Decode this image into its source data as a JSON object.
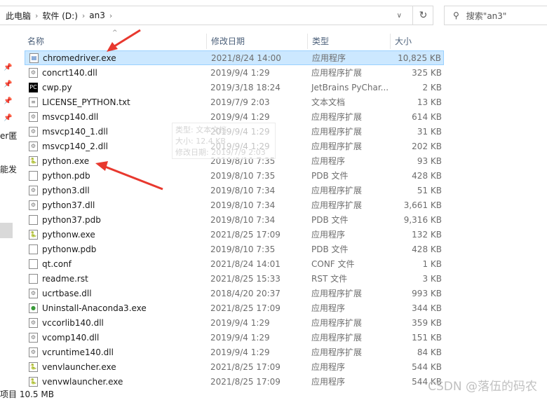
{
  "address": {
    "crumbs": [
      "此电脑",
      "软件 (D:)",
      "an3"
    ]
  },
  "search": {
    "placeholder": "搜索\"an3\""
  },
  "columns": [
    "名称",
    "修改日期",
    "类型",
    "大小"
  ],
  "sidebar": {
    "text1": "er匿",
    "text2": "能发"
  },
  "files": [
    {
      "name": "chromedriver.exe",
      "date": "2021/8/24 14:00",
      "type": "应用程序",
      "size": "10,825 KB",
      "icon": "exe"
    },
    {
      "name": "concrt140.dll",
      "date": "2019/9/4 1:29",
      "type": "应用程序扩展",
      "size": "325 KB",
      "icon": "dll"
    },
    {
      "name": "cwp.py",
      "date": "2019/3/18 18:24",
      "type": "JetBrains PyChar...",
      "size": "2 KB",
      "icon": "pycharm"
    },
    {
      "name": "LICENSE_PYTHON.txt",
      "date": "2019/7/9 2:03",
      "type": "文本文档",
      "size": "13 KB",
      "icon": "txt"
    },
    {
      "name": "msvcp140.dll",
      "date": "2019/9/4 1:29",
      "type": "应用程序扩展",
      "size": "614 KB",
      "icon": "dll"
    },
    {
      "name": "msvcp140_1.dll",
      "date": "2019/9/4 1:29",
      "type": "应用程序扩展",
      "size": "31 KB",
      "icon": "dll"
    },
    {
      "name": "msvcp140_2.dll",
      "date": "2019/9/4 1:29",
      "type": "应用程序扩展",
      "size": "202 KB",
      "icon": "dll"
    },
    {
      "name": "python.exe",
      "date": "2019/8/10 7:35",
      "type": "应用程序",
      "size": "93 KB",
      "icon": "python"
    },
    {
      "name": "python.pdb",
      "date": "2019/8/10 7:35",
      "type": "PDB 文件",
      "size": "428 KB",
      "icon": "file"
    },
    {
      "name": "python3.dll",
      "date": "2019/8/10 7:34",
      "type": "应用程序扩展",
      "size": "51 KB",
      "icon": "dll"
    },
    {
      "name": "python37.dll",
      "date": "2019/8/10 7:34",
      "type": "应用程序扩展",
      "size": "3,661 KB",
      "icon": "dll"
    },
    {
      "name": "python37.pdb",
      "date": "2019/8/10 7:34",
      "type": "PDB 文件",
      "size": "9,316 KB",
      "icon": "file"
    },
    {
      "name": "pythonw.exe",
      "date": "2021/8/25 17:09",
      "type": "应用程序",
      "size": "132 KB",
      "icon": "python"
    },
    {
      "name": "pythonw.pdb",
      "date": "2019/8/10 7:35",
      "type": "PDB 文件",
      "size": "428 KB",
      "icon": "file"
    },
    {
      "name": "qt.conf",
      "date": "2021/8/24 14:01",
      "type": "CONF 文件",
      "size": "1 KB",
      "icon": "file"
    },
    {
      "name": "readme.rst",
      "date": "2021/8/25 15:33",
      "type": "RST 文件",
      "size": "3 KB",
      "icon": "file"
    },
    {
      "name": "ucrtbase.dll",
      "date": "2018/4/20 20:37",
      "type": "应用程序扩展",
      "size": "993 KB",
      "icon": "dll"
    },
    {
      "name": "Uninstall-Anaconda3.exe",
      "date": "2021/8/25 17:09",
      "type": "应用程序",
      "size": "344 KB",
      "icon": "uninstall"
    },
    {
      "name": "vccorlib140.dll",
      "date": "2019/9/4 1:29",
      "type": "应用程序扩展",
      "size": "359 KB",
      "icon": "dll"
    },
    {
      "name": "vcomp140.dll",
      "date": "2019/9/4 1:29",
      "type": "应用程序扩展",
      "size": "151 KB",
      "icon": "dll"
    },
    {
      "name": "vcruntime140.dll",
      "date": "2019/9/4 1:29",
      "type": "应用程序扩展",
      "size": "84 KB",
      "icon": "dll"
    },
    {
      "name": "venvlauncher.exe",
      "date": "2021/8/25 17:09",
      "type": "应用程序",
      "size": "544 KB",
      "icon": "python"
    },
    {
      "name": "venvwlauncher.exe",
      "date": "2021/8/25 17:09",
      "type": "应用程序",
      "size": "544 KB",
      "icon": "python"
    }
  ],
  "tooltip": {
    "type": "类型: 文本文档",
    "size": "大小: 12.4 KB",
    "date": "修改日期: 2019/7/9 2:03"
  },
  "status": {
    "text": "项目  10.5 MB"
  },
  "watermark": "CSDN @落伍的码农"
}
